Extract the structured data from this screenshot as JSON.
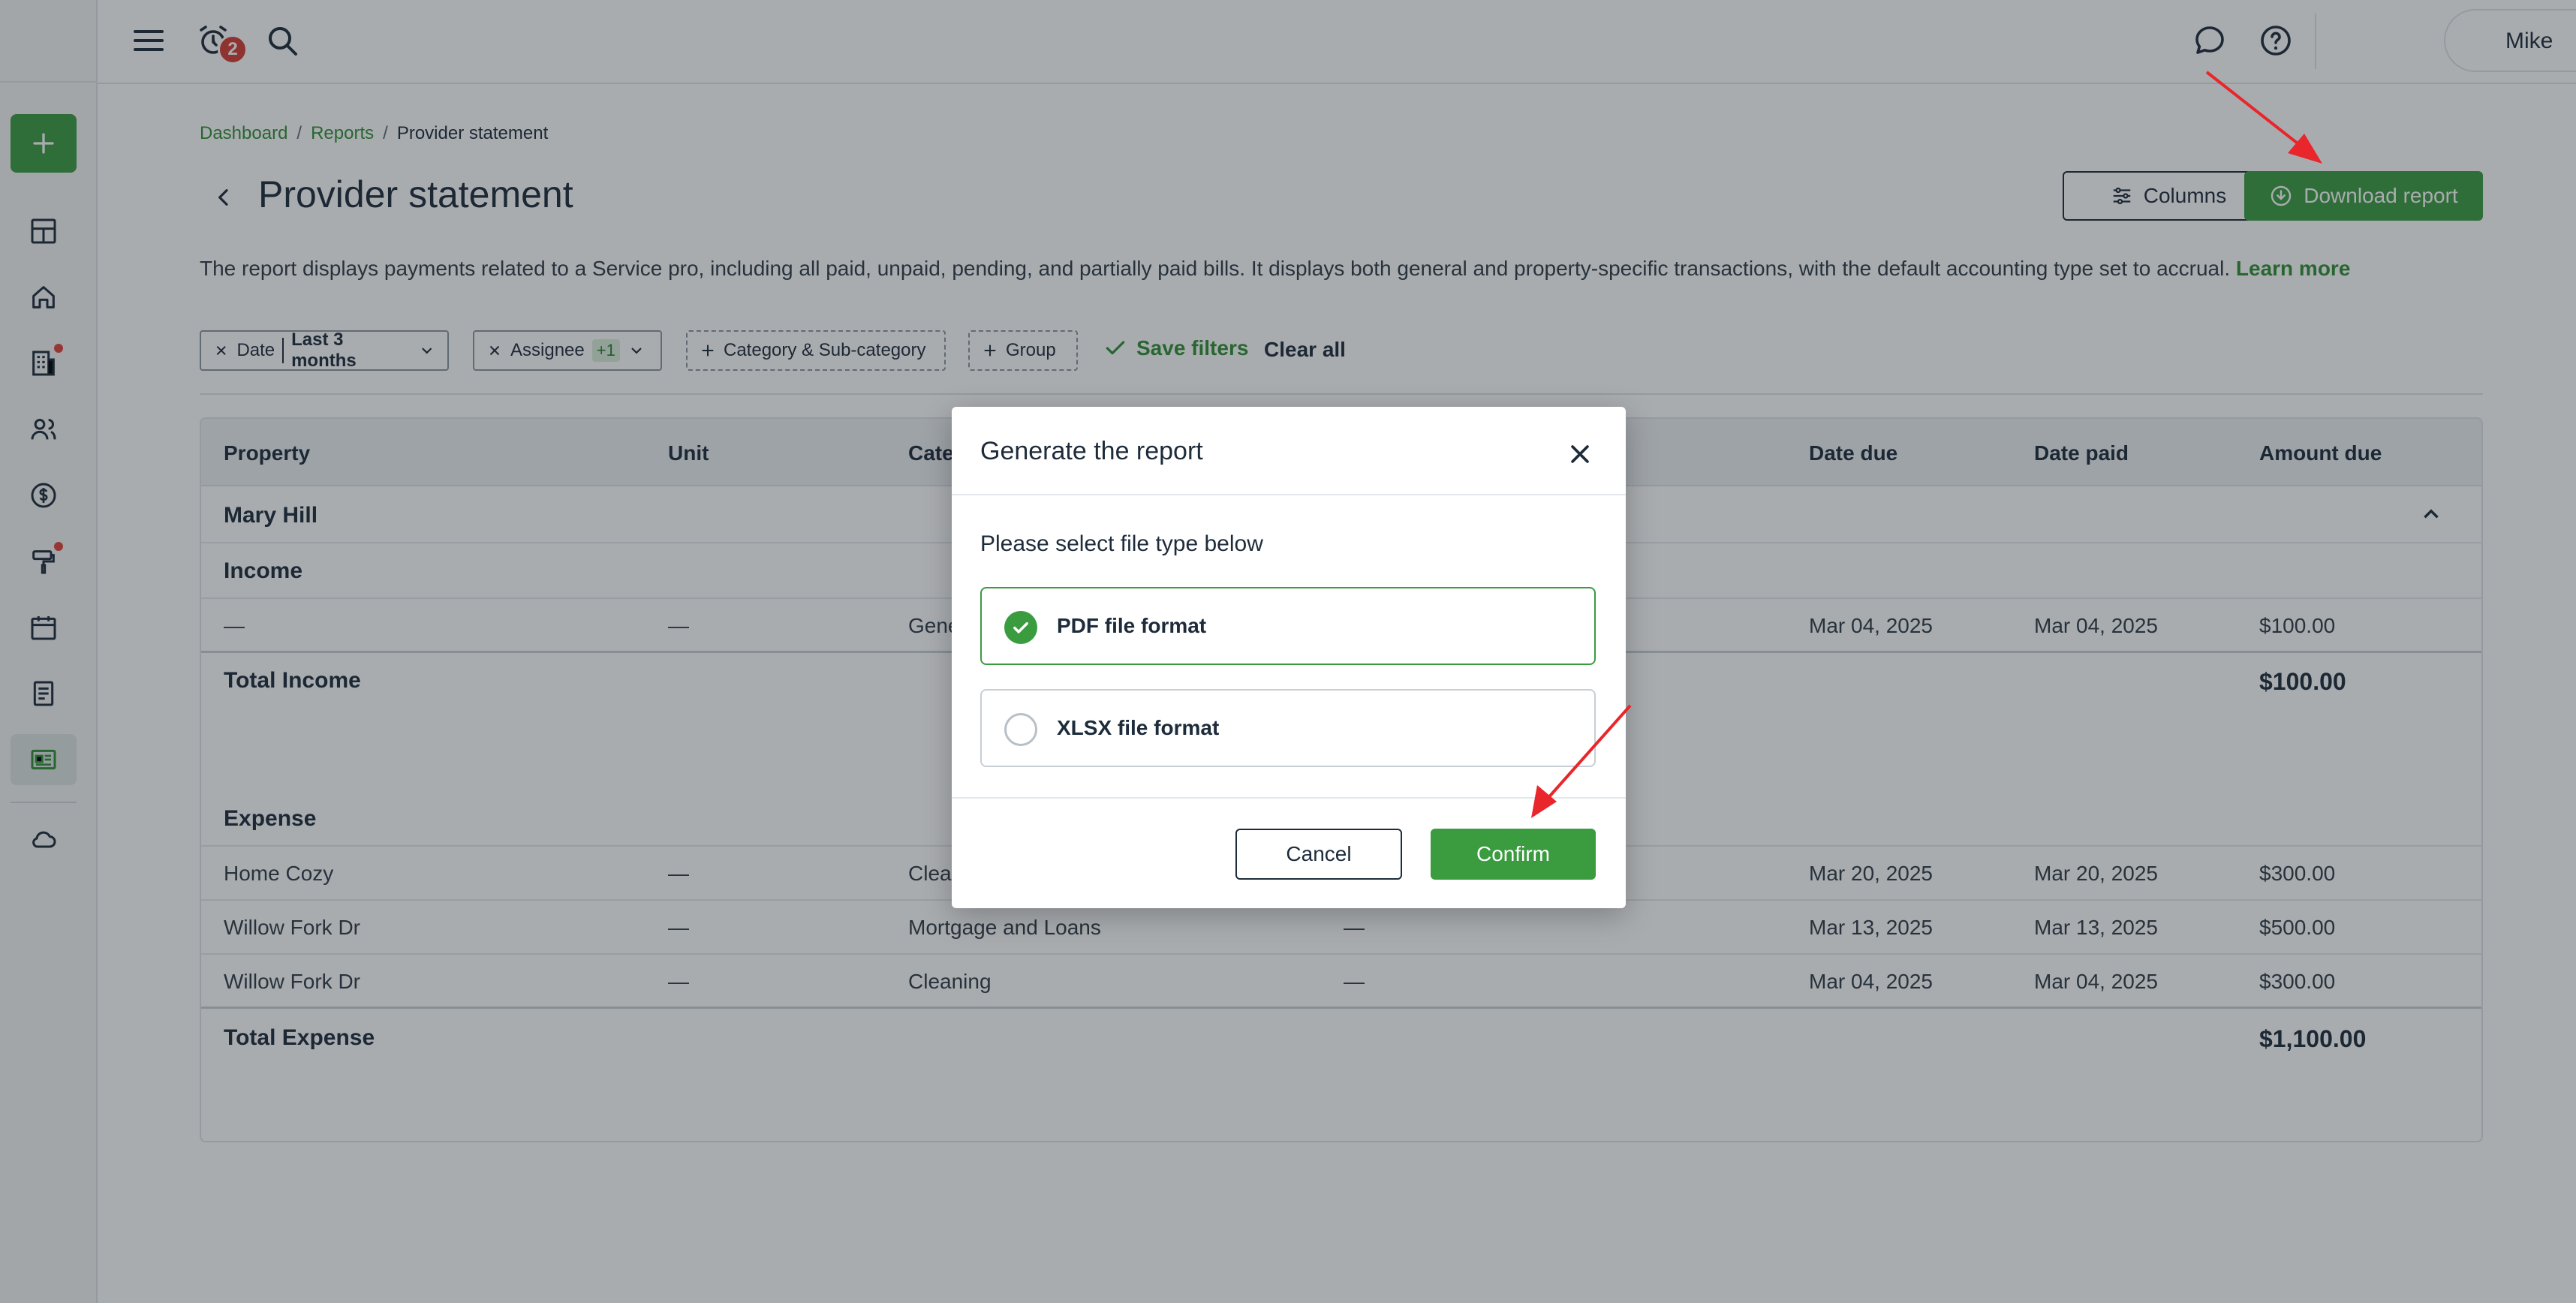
{
  "topbar": {
    "notification_count": "2",
    "user_name": "Mike"
  },
  "breadcrumb": {
    "items": [
      "Dashboard",
      "Reports",
      "Provider statement"
    ],
    "separator": "/"
  },
  "page": {
    "title": "Provider statement",
    "columns_label": "Columns",
    "download_label": "Download report",
    "description": "The report displays payments related to a Service pro, including all paid, unpaid, pending, and partially paid bills. It displays both general and property-specific transactions, with the default accounting type set to accrual.",
    "learn_more": "Learn more"
  },
  "filters": {
    "date_label": "Date",
    "date_value": "Last 3 months",
    "assignee_label": "Assignee",
    "assignee_extra": "+1",
    "category_label": "Category & Sub-category",
    "group_label": "Group",
    "save_label": "Save filters",
    "clear_label": "Clear all"
  },
  "table": {
    "headers": [
      "Property",
      "Unit",
      "Cate",
      "Date due",
      "Date paid",
      "Amount due"
    ],
    "group_name": "Mary Hill",
    "income_label": "Income",
    "income_rows": [
      {
        "property": "—",
        "unit": "—",
        "category": "Gene",
        "date_due": "Mar 04, 2025",
        "date_paid": "Mar 04, 2025",
        "amount": "$100.00"
      }
    ],
    "total_income_label": "Total Income",
    "total_income_value": "$100.00",
    "expense_label": "Expense",
    "expense_rows": [
      {
        "property": "Home Cozy",
        "unit": "—",
        "category": "Clea",
        "extra": "",
        "date_due": "Mar 20, 2025",
        "date_paid": "Mar 20, 2025",
        "amount": "$300.00"
      },
      {
        "property": "Willow Fork Dr",
        "unit": "—",
        "category": "Mortgage and Loans",
        "extra": "—",
        "date_due": "Mar 13, 2025",
        "date_paid": "Mar 13, 2025",
        "amount": "$500.00"
      },
      {
        "property": "Willow Fork Dr",
        "unit": "—",
        "category": "Cleaning",
        "extra": "—",
        "date_due": "Mar 04, 2025",
        "date_paid": "Mar 04, 2025",
        "amount": "$300.00"
      }
    ],
    "total_expense_label": "Total Expense",
    "total_expense_value": "$1,100.00"
  },
  "modal": {
    "title": "Generate the report",
    "subtitle": "Please select file type below",
    "options": [
      {
        "label": "PDF file format",
        "selected": true
      },
      {
        "label": "XLSX file format",
        "selected": false
      }
    ],
    "cancel_label": "Cancel",
    "confirm_label": "Confirm"
  },
  "colors": {
    "accent": "#3a9b3f",
    "badge": "#d63c33",
    "annotation_arrow": "#e8262b"
  }
}
